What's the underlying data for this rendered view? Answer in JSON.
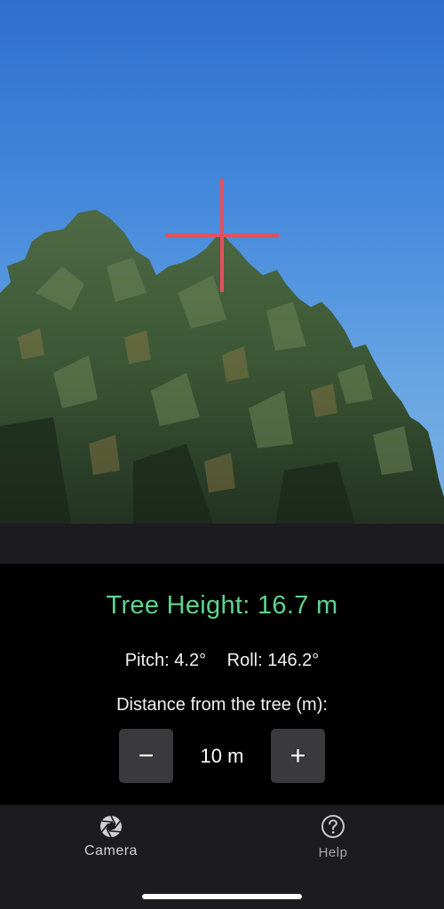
{
  "camera_view": {
    "crosshair_color": "#e0515e"
  },
  "results": {
    "tree_height": "Tree Height: 16.7 m",
    "tree_height_color": "#5fd38d",
    "pitch": "Pitch: 4.2°",
    "roll": "Roll: 146.2°"
  },
  "distance": {
    "label": "Distance from the tree (m):",
    "value": "10 m",
    "decrement_symbol": "−",
    "increment_symbol": "+"
  },
  "tabbar": {
    "tabs": [
      {
        "label": "Camera",
        "icon": "camera-aperture-icon",
        "selected": true
      },
      {
        "label": "Help",
        "icon": "question-circle-icon",
        "selected": false
      }
    ]
  }
}
